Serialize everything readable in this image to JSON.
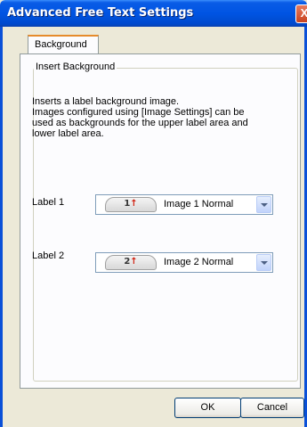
{
  "window": {
    "title": "Advanced Free Text Settings",
    "close_glyph": "X"
  },
  "tabs": [
    {
      "label": "Background",
      "selected": true
    }
  ],
  "group": {
    "title": "Insert Background",
    "description": "Inserts a label background image.\nImages configured using [Image Settings] can be\nused as backgrounds for the upper label area and\nlower label area."
  },
  "labels": [
    {
      "label": "Label 1",
      "badge_num": "1",
      "badge_arrow": "↑",
      "value": "Image 1 Normal"
    },
    {
      "label": "Label 2",
      "badge_num": "2",
      "badge_arrow": "↑",
      "value": "Image 2 Normal"
    }
  ],
  "buttons": {
    "ok": "OK",
    "cancel": "Cancel"
  }
}
